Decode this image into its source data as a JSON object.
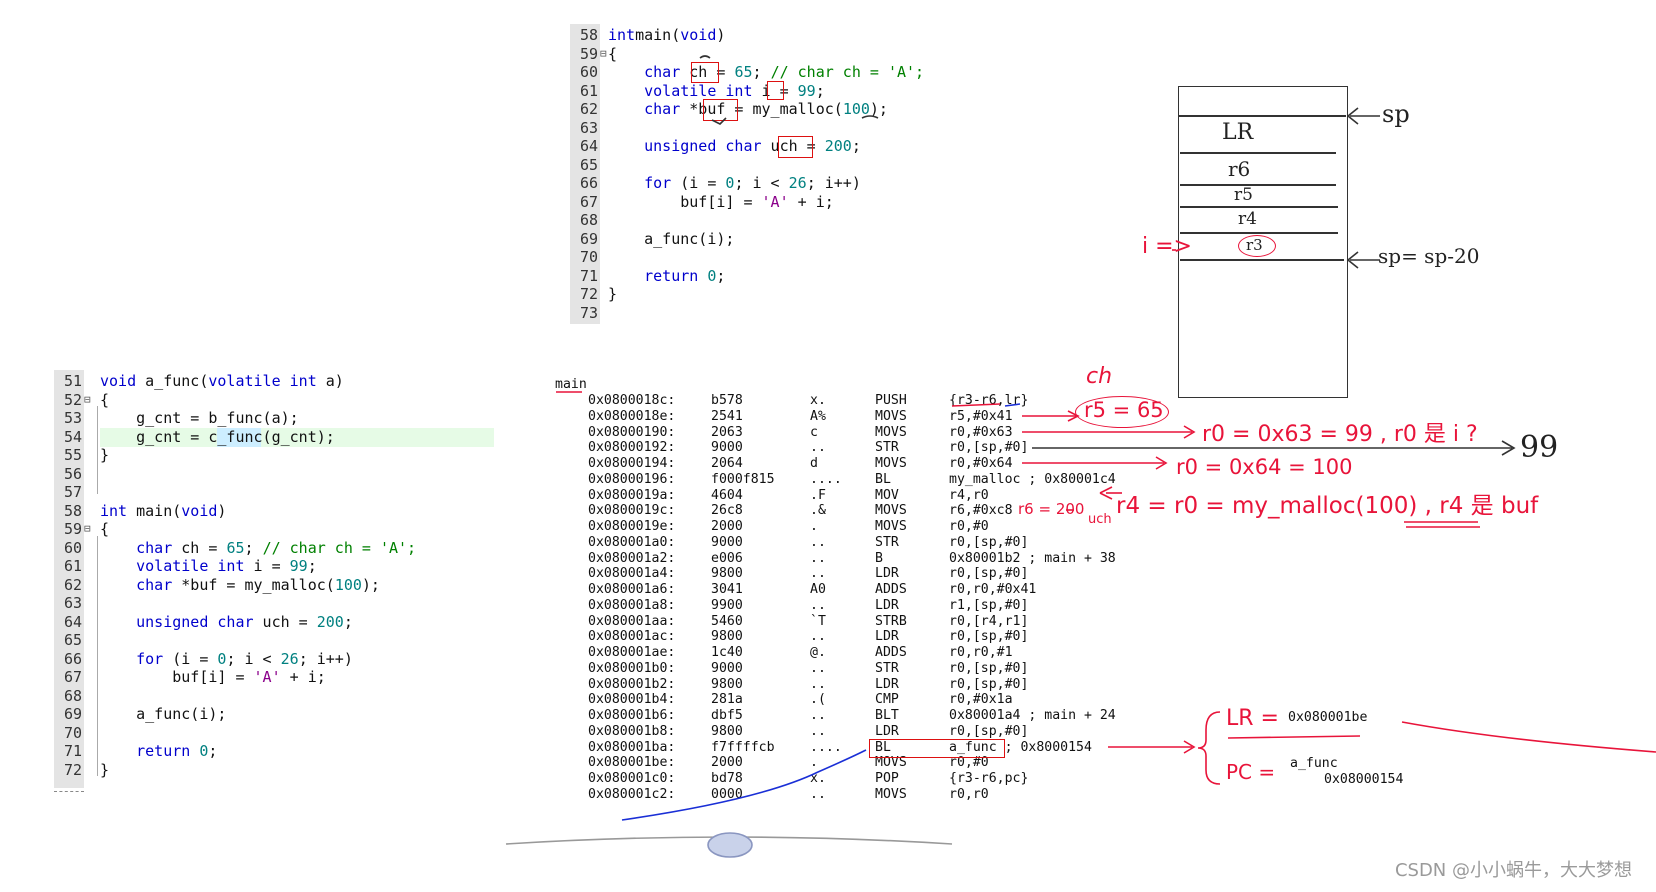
{
  "top_code": {
    "lines": [
      {
        "n": "58",
        "fold": "",
        "text": [
          [
            "kw",
            "int"
          ],
          [
            "",
            "main("
          ],
          [
            "kw",
            "void"
          ],
          [
            "",
            ")"
          ]
        ]
      },
      {
        "n": "59",
        "fold": "⊟",
        "text": [
          [
            "",
            "{"
          ]
        ]
      },
      {
        "n": "60",
        "fold": "",
        "text": [
          [
            "",
            "    "
          ],
          [
            "kw",
            "char"
          ],
          [
            "",
            " ch = "
          ],
          [
            "num",
            "65"
          ],
          [
            "",
            "; "
          ],
          [
            "cmt",
            "// char ch = 'A';"
          ]
        ]
      },
      {
        "n": "61",
        "fold": "",
        "text": [
          [
            "",
            "    "
          ],
          [
            "kw",
            "volatile int"
          ],
          [
            "",
            " i = "
          ],
          [
            "num",
            "99"
          ],
          [
            "",
            ";"
          ]
        ]
      },
      {
        "n": "62",
        "fold": "",
        "text": [
          [
            "",
            "    "
          ],
          [
            "kw",
            "char"
          ],
          [
            "",
            " *buf = my_malloc("
          ],
          [
            "num",
            "100"
          ],
          [
            "",
            ");"
          ]
        ]
      },
      {
        "n": "63",
        "fold": "",
        "text": [
          [
            "",
            ""
          ]
        ]
      },
      {
        "n": "64",
        "fold": "",
        "text": [
          [
            "",
            "    "
          ],
          [
            "kw",
            "unsigned char"
          ],
          [
            "",
            " uch = "
          ],
          [
            "num",
            "200"
          ],
          [
            "",
            ";"
          ]
        ]
      },
      {
        "n": "65",
        "fold": "",
        "text": [
          [
            "",
            ""
          ]
        ]
      },
      {
        "n": "66",
        "fold": "",
        "text": [
          [
            "",
            "    "
          ],
          [
            "kw",
            "for"
          ],
          [
            "",
            " (i = "
          ],
          [
            "num",
            "0"
          ],
          [
            "",
            "; i < "
          ],
          [
            "num",
            "26"
          ],
          [
            "",
            "; i++)"
          ]
        ]
      },
      {
        "n": "67",
        "fold": "",
        "text": [
          [
            "",
            "        buf[i] = "
          ],
          [
            "str",
            "'A'"
          ],
          [
            "",
            " + i;"
          ]
        ]
      },
      {
        "n": "68",
        "fold": "",
        "text": [
          [
            "",
            ""
          ]
        ]
      },
      {
        "n": "69",
        "fold": "",
        "text": [
          [
            "",
            "    a_func(i);"
          ]
        ]
      },
      {
        "n": "70",
        "fold": "",
        "text": [
          [
            "",
            ""
          ]
        ]
      },
      {
        "n": "71",
        "fold": "",
        "text": [
          [
            "",
            "    "
          ],
          [
            "kw",
            "return"
          ],
          [
            "",
            " "
          ],
          [
            "num",
            "0"
          ],
          [
            "",
            ";"
          ]
        ]
      },
      {
        "n": "72",
        "fold": "",
        "text": [
          [
            "",
            "}"
          ]
        ]
      },
      {
        "n": "73",
        "fold": "",
        "text": [
          [
            "",
            ""
          ]
        ]
      }
    ]
  },
  "bottom_code": {
    "lines": [
      {
        "n": "51",
        "fold": "",
        "text": [
          [
            "kw",
            "void"
          ],
          [
            "",
            " a_func("
          ],
          [
            "kw",
            "volatile int"
          ],
          [
            "",
            " a)"
          ]
        ]
      },
      {
        "n": "52",
        "fold": "⊟",
        "text": [
          [
            "",
            "{"
          ]
        ]
      },
      {
        "n": "53",
        "fold": "",
        "text": [
          [
            "",
            "    g_cnt = b_func(a);"
          ]
        ]
      },
      {
        "n": "54",
        "fold": "",
        "text": [
          [
            "",
            "    g_cnt = c_func(g_cnt);"
          ]
        ]
      },
      {
        "n": "55",
        "fold": "",
        "text": [
          [
            "",
            "}"
          ]
        ]
      },
      {
        "n": "56",
        "fold": "",
        "text": [
          [
            "",
            ""
          ]
        ]
      },
      {
        "n": "57",
        "fold": "",
        "text": [
          [
            "",
            ""
          ]
        ]
      },
      {
        "n": "58",
        "fold": "",
        "text": [
          [
            "kw",
            "int"
          ],
          [
            "",
            " main("
          ],
          [
            "kw",
            "void"
          ],
          [
            "",
            ")"
          ]
        ]
      },
      {
        "n": "59",
        "fold": "⊟",
        "text": [
          [
            "",
            "{"
          ]
        ]
      },
      {
        "n": "60",
        "fold": "",
        "text": [
          [
            "",
            "    "
          ],
          [
            "kw",
            "char"
          ],
          [
            "",
            " ch = "
          ],
          [
            "num",
            "65"
          ],
          [
            "",
            "; "
          ],
          [
            "cmt",
            "// char ch = 'A';"
          ]
        ]
      },
      {
        "n": "61",
        "fold": "",
        "text": [
          [
            "",
            "    "
          ],
          [
            "kw",
            "volatile int"
          ],
          [
            "",
            " i = "
          ],
          [
            "num",
            "99"
          ],
          [
            "",
            ";"
          ]
        ]
      },
      {
        "n": "62",
        "fold": "",
        "text": [
          [
            "",
            "    "
          ],
          [
            "kw",
            "char"
          ],
          [
            "",
            " *buf = my_malloc("
          ],
          [
            "num",
            "100"
          ],
          [
            "",
            ");"
          ]
        ]
      },
      {
        "n": "63",
        "fold": "",
        "text": [
          [
            "",
            ""
          ]
        ]
      },
      {
        "n": "64",
        "fold": "",
        "text": [
          [
            "",
            "    "
          ],
          [
            "kw",
            "unsigned char"
          ],
          [
            "",
            " uch = "
          ],
          [
            "num",
            "200"
          ],
          [
            "",
            ";"
          ]
        ]
      },
      {
        "n": "65",
        "fold": "",
        "text": [
          [
            "",
            ""
          ]
        ]
      },
      {
        "n": "66",
        "fold": "",
        "text": [
          [
            "",
            "    "
          ],
          [
            "kw",
            "for"
          ],
          [
            "",
            " (i = "
          ],
          [
            "num",
            "0"
          ],
          [
            "",
            "; i < "
          ],
          [
            "num",
            "26"
          ],
          [
            "",
            "; i++)"
          ]
        ]
      },
      {
        "n": "67",
        "fold": "",
        "text": [
          [
            "",
            "        buf[i] = "
          ],
          [
            "str",
            "'A'"
          ],
          [
            "",
            " + i;"
          ]
        ]
      },
      {
        "n": "68",
        "fold": "",
        "text": [
          [
            "",
            ""
          ]
        ]
      },
      {
        "n": "69",
        "fold": "",
        "text": [
          [
            "",
            "    a_func(i);"
          ]
        ]
      },
      {
        "n": "70",
        "fold": "",
        "text": [
          [
            "",
            ""
          ]
        ]
      },
      {
        "n": "71",
        "fold": "",
        "text": [
          [
            "",
            "    "
          ],
          [
            "kw",
            "return"
          ],
          [
            "",
            " "
          ],
          [
            "num",
            "0"
          ],
          [
            "",
            ";"
          ]
        ]
      },
      {
        "n": "72",
        "fold": "",
        "text": [
          [
            "",
            "}"
          ]
        ]
      }
    ]
  },
  "disasm": {
    "label": "main",
    "rows": [
      [
        "0x0800018c:",
        "b578",
        "x.",
        "PUSH",
        "{r3-r6,lr}"
      ],
      [
        "0x0800018e:",
        "2541",
        "A%",
        "MOVS",
        "r5,#0x41"
      ],
      [
        "0x08000190:",
        "2063",
        "c",
        "MOVS",
        "r0,#0x63"
      ],
      [
        "0x08000192:",
        "9000",
        "..",
        "STR",
        "r0,[sp,#0]"
      ],
      [
        "0x08000194:",
        "2064",
        "d",
        "MOVS",
        "r0,#0x64"
      ],
      [
        "0x08000196:",
        "f000f815",
        "....",
        "BL",
        "my_malloc ; 0x80001c4"
      ],
      [
        "0x0800019a:",
        "4604",
        ".F",
        "MOV",
        "r4,r0"
      ],
      [
        "0x0800019c:",
        "26c8",
        ".&",
        "MOVS",
        "r6,#0xc8"
      ],
      [
        "0x0800019e:",
        "2000",
        ".",
        "MOVS",
        "r0,#0"
      ],
      [
        "0x080001a0:",
        "9000",
        "..",
        "STR",
        "r0,[sp,#0]"
      ],
      [
        "0x080001a2:",
        "e006",
        "..",
        "B",
        "0x80001b2 ; main + 38"
      ],
      [
        "0x080001a4:",
        "9800",
        "..",
        "LDR",
        "r0,[sp,#0]"
      ],
      [
        "0x080001a6:",
        "3041",
        "A0",
        "ADDS",
        "r0,r0,#0x41"
      ],
      [
        "0x080001a8:",
        "9900",
        "..",
        "LDR",
        "r1,[sp,#0]"
      ],
      [
        "0x080001aa:",
        "5460",
        "`T",
        "STRB",
        "r0,[r4,r1]"
      ],
      [
        "0x080001ac:",
        "9800",
        "..",
        "LDR",
        "r0,[sp,#0]"
      ],
      [
        "0x080001ae:",
        "1c40",
        "@.",
        "ADDS",
        "r0,r0,#1"
      ],
      [
        "0x080001b0:",
        "9000",
        "..",
        "STR",
        "r0,[sp,#0]"
      ],
      [
        "0x080001b2:",
        "9800",
        "..",
        "LDR",
        "r0,[sp,#0]"
      ],
      [
        "0x080001b4:",
        "281a",
        ".(",
        "CMP",
        "r0,#0x1a"
      ],
      [
        "0x080001b6:",
        "dbf5",
        "..",
        "BLT",
        "0x80001a4 ; main + 24"
      ],
      [
        "0x080001b8:",
        "9800",
        "..",
        "LDR",
        "r0,[sp,#0]"
      ],
      [
        "0x080001ba:",
        "f7ffffcb",
        "....",
        "BL",
        "a_func ; 0x8000154"
      ],
      [
        "0x080001be:",
        "2000",
        ".",
        "MOVS",
        "r0,#0"
      ],
      [
        "0x080001c0:",
        "bd78",
        "x.",
        "POP",
        "{r3-r6,pc}"
      ],
      [
        "0x080001c2:",
        "0000",
        "..",
        "MOVS",
        "r0,r0"
      ]
    ]
  },
  "stack": {
    "cells": [
      "LR",
      "r6",
      "r5",
      "r4",
      "r3"
    ],
    "sp_label": "sp",
    "sp_new_label": "sp= sp-20",
    "i_label": "i =>"
  },
  "notes": {
    "ch": "ch",
    "r5": "r5 = 65",
    "r0_99": "r0 = 0x63 = 99 ,  r0 是 i ?",
    "ninety_nine": "99",
    "r0_100": "r0 = 0x64 = 100",
    "r4": "r4 = r0 = my_malloc(100) ,  r4 是 buf",
    "r6": "r6 = 200",
    "uch": "uch",
    "lr_label": "LR =",
    "lr_value": "0x080001be",
    "pc_label": "PC =",
    "pc_func": "a_func",
    "pc_value": "0x08000154"
  },
  "watermark": "CSDN @小小蜗牛，大大梦想",
  "colors": {
    "keyword": "#0000cc",
    "number": "#008080",
    "comment": "#008000",
    "string": "#8b008b",
    "annot_red": "#e8143a",
    "annot_blue": "#1a2fd6"
  }
}
